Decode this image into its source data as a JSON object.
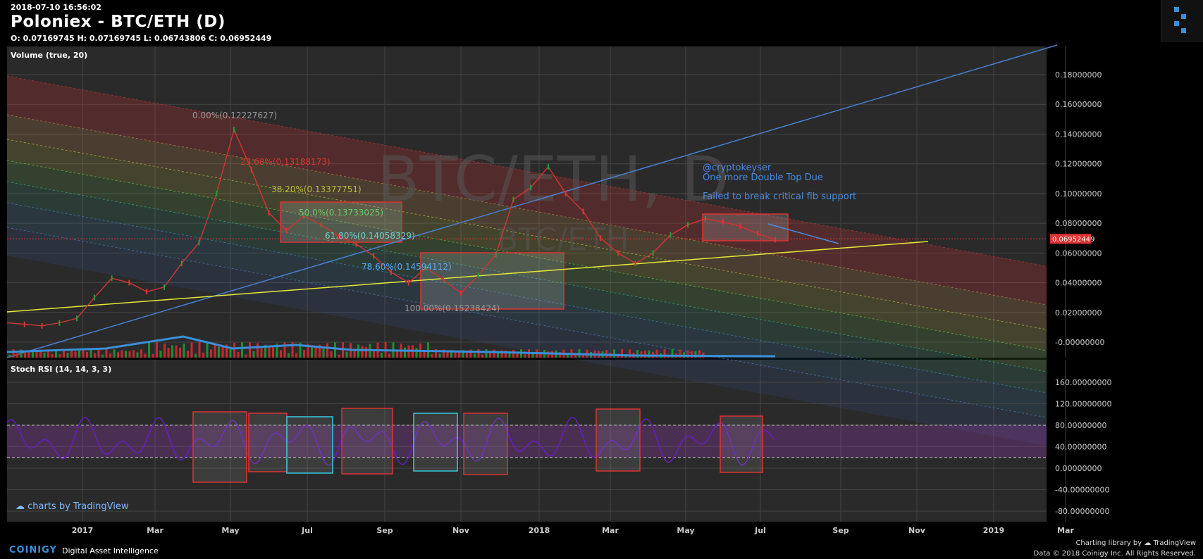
{
  "header": {
    "timestamp": "2018-07-10 16:56:02",
    "title": "Poloniex - BTC/ETH (D)",
    "ohlc": "O: 0.07169745 H: 0.07169745 L: 0.06743806 C: 0.06952449"
  },
  "watermark": {
    "main": "BTC/ETH, D",
    "secondary": "BTC/ETH"
  },
  "footer": {
    "brand": "COINIGY",
    "tagline": "Digital Asset Intelligence",
    "charting_library": "Charting library by",
    "tv_name": "TradingView",
    "rights": "Data © 2018 Coinigy Inc. All Rights Reserved."
  },
  "tradingview_badge": "charts by TradingView",
  "colors": {
    "bg": "#000000",
    "panel": "#2b2b2b",
    "grid": "#444444",
    "accent": "#3a8fd9",
    "up": "#1e8f2e",
    "down": "#c8282d",
    "yellow": "#e7e73a",
    "rsi": "#6a1bd0"
  },
  "chart_data": [
    {
      "type": "line",
      "title": "Volume (true, 20)",
      "x_ticks": [
        "2017",
        "Mar",
        "May",
        "Jul",
        "Sep",
        "Nov",
        "2018",
        "Mar",
        "May",
        "Jul",
        "Sep",
        "Nov",
        "2019",
        "Mar"
      ],
      "y_ticks": [
        "0.18000000",
        "0.16000000",
        "0.14000000",
        "0.12000000",
        "0.10000000",
        "0.08000000",
        "0.06000000",
        "0.04000000",
        "0.02000000",
        "-0.00000000"
      ],
      "ylim": [
        -0.01,
        0.2
      ],
      "last_price": "0.06952449",
      "series": [
        {
          "values": [
            0.013,
            0.012,
            0.011,
            0.013,
            0.016,
            0.03,
            0.043,
            0.04,
            0.034,
            0.037,
            0.053,
            0.067,
            0.1,
            0.143,
            0.116,
            0.087,
            0.075,
            0.085,
            0.079,
            0.071,
            0.066,
            0.058,
            0.047,
            0.04,
            0.05,
            0.042,
            0.033,
            0.045,
            0.059,
            0.096,
            0.104,
            0.118,
            0.1,
            0.088,
            0.07,
            0.06,
            0.053,
            0.06,
            0.072,
            0.079,
            0.083,
            0.081,
            0.078,
            0.073,
            0.069
          ]
        }
      ],
      "fib_labels": [
        "0.00%(0.12227627)",
        "23.60%(0.13188173)",
        "38.20%(0.13377751)",
        "50.0%(0.13733025)",
        "61.80%(0.14058329)",
        "78.60%(0.14594112)",
        "100.00%(0.15238424)"
      ],
      "annotations": [
        "@cryptokeyser",
        "One more Double Top Due",
        "Failed to break critical fib support"
      ]
    },
    {
      "type": "line",
      "title": "Stoch RSI (14, 14, 3, 3)",
      "y_ticks": [
        "160.00000000",
        "120.00000000",
        "80.00000000",
        "40.00000000",
        "0.00000000",
        "-40.00000000",
        "-80.00000000"
      ],
      "ylim": [
        -100,
        180
      ],
      "bands": [
        20,
        80
      ]
    }
  ]
}
